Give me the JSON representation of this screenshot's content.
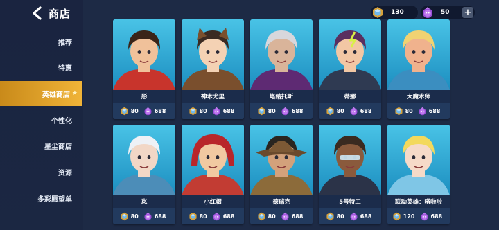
{
  "header": {
    "title": "商店"
  },
  "sidebar": {
    "items": [
      {
        "label": "推荐",
        "active": false
      },
      {
        "label": "特惠",
        "active": false
      },
      {
        "label": "英雄商店",
        "active": true,
        "badge": "★"
      },
      {
        "label": "个性化",
        "active": false
      },
      {
        "label": "星尘商店",
        "active": false
      },
      {
        "label": "资源",
        "active": false
      },
      {
        "label": "多彩愿望单",
        "active": false
      }
    ]
  },
  "currency": {
    "gems": {
      "value": "130",
      "icon": "blue-gem-coin-icon"
    },
    "purple": {
      "value": "50",
      "icon": "purple-drop-coin-icon"
    },
    "plus_label": "+"
  },
  "colors": {
    "active_tab": "#e8a830",
    "sidebar_bg": "#1a2440",
    "card_bg": "#42b9df"
  },
  "heroes": [
    {
      "name": "彤",
      "gem_price": "80",
      "purple_price": "688"
    },
    {
      "name": "神木尤里",
      "gem_price": "80",
      "purple_price": "688"
    },
    {
      "name": "塔纳托斯",
      "gem_price": "80",
      "purple_price": "688"
    },
    {
      "name": "蒂娜",
      "gem_price": "80",
      "purple_price": "688"
    },
    {
      "name": "大魔术师",
      "gem_price": "80",
      "purple_price": "688"
    },
    {
      "name": "岚",
      "gem_price": "80",
      "purple_price": "688"
    },
    {
      "name": "小红帽",
      "gem_price": "80",
      "purple_price": "688"
    },
    {
      "name": "德瑞克",
      "gem_price": "80",
      "purple_price": "688"
    },
    {
      "name": "5号特工",
      "gem_price": "80",
      "purple_price": "688"
    },
    {
      "name": "联动英雄：嗒啦啦",
      "gem_price": "120",
      "purple_price": "688"
    }
  ]
}
